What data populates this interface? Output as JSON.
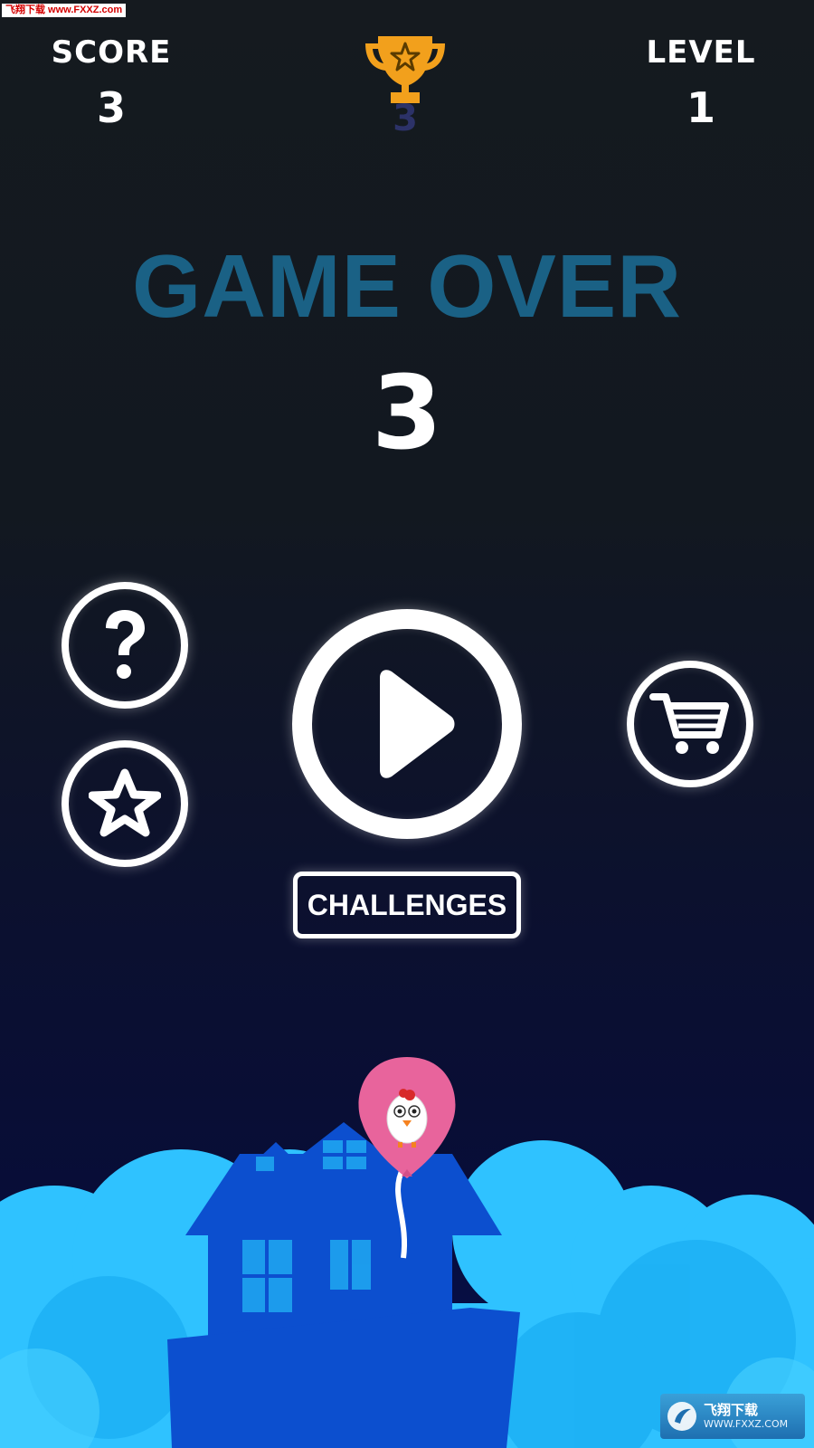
{
  "watermark_top": "飞翔下载 www.FXXZ.com",
  "hud": {
    "score_label": "SCORE",
    "score_value": "3",
    "level_label": "LEVEL",
    "level_value": "1",
    "best_value": "3",
    "trophy_icon": "trophy-icon"
  },
  "game_over": {
    "title": "GAME OVER",
    "final_score": "3"
  },
  "buttons": {
    "help_icon": "question-mark-icon",
    "rate_icon": "star-icon",
    "play_icon": "play-icon",
    "shop_icon": "shopping-cart-icon",
    "challenges_label": "CHALLENGES"
  },
  "watermark_bottom": {
    "name": "飞翔下载",
    "url": "WWW.FXXZ.COM"
  },
  "colors": {
    "title": "#1a6185",
    "trophy": "#f2a01c",
    "balloon": "#e8649c",
    "cloud_light": "#2fc2ff",
    "cloud_dark": "#0c4fcf"
  }
}
